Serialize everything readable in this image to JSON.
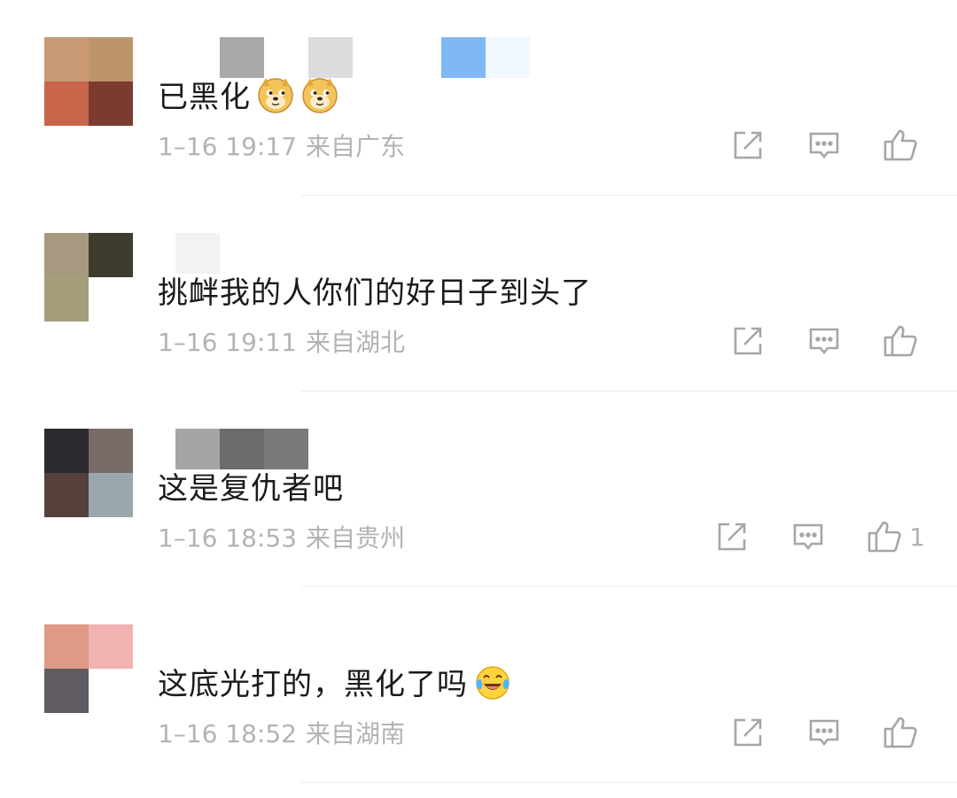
{
  "comments": [
    {
      "text": "已黑化",
      "emojis": [
        "doge-emoji",
        "doge-emoji"
      ],
      "date": "1–16 19:17",
      "location": "来自广东",
      "likes": "",
      "avatar_colors": [
        "#c99a73",
        "#bd956b",
        "#c9654b",
        "#7d3b2f"
      ],
      "name_blur_colors": [
        "#ffffff",
        "#a8a8a8",
        "#ffffff",
        "#dcdcdc",
        "#ffffff",
        "#ffffff",
        "#7fb7f7",
        "#f0f7ff"
      ]
    },
    {
      "text": "挑衅我的人你们的好日子到头了",
      "emojis": [],
      "date": "1–16 19:11",
      "location": "来自湖北",
      "likes": "",
      "avatar_colors": [
        "#a7997f",
        "#3f3b2d",
        "#a49e7c",
        "#ffffff"
      ],
      "name_blur_colors": [
        "#f2f2f2"
      ]
    },
    {
      "text": "这是复仇者吧",
      "emojis": [],
      "date": "1–16 18:53",
      "location": "来自贵州",
      "likes": "1",
      "avatar_colors": [
        "#2a2a2e",
        "#7a6a68",
        "#55403c",
        "#9aa7ad"
      ],
      "name_blur_colors": [
        "#a5a5a5",
        "#6b6b6b",
        "#7a7a7a",
        "#ffffff"
      ]
    },
    {
      "text": "这底光打的，黑化了吗",
      "emojis": [
        "laugh-cry-emoji"
      ],
      "date": "1–16 18:52",
      "location": "来自湖南",
      "likes": "",
      "avatar_colors": [
        "#df9a86",
        "#f1b3b1",
        "#615b63",
        "#ffffff"
      ],
      "name_blur_colors": []
    }
  ],
  "icons": {
    "repost": "repost-icon",
    "comment": "comment-icon",
    "like": "thumbs-up-icon"
  },
  "colors": {
    "text": "#1a1a1a",
    "meta": "#b3b3b3",
    "icon": "#a6a6a6"
  }
}
